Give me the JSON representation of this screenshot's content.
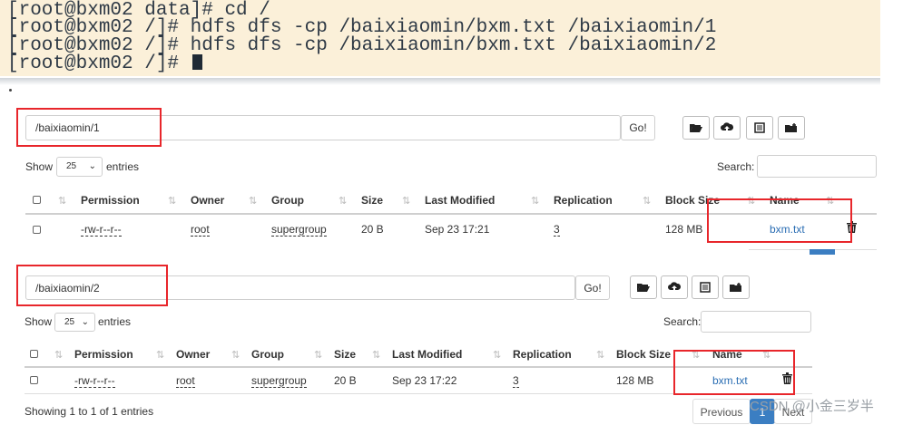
{
  "terminal": {
    "lines": [
      "[root@bxm02 data]# cd /",
      "[root@bxm02 /]# hdfs dfs -cp /baixiaomin/bxm.txt /baixiaomin/1",
      "[root@bxm02 /]# hdfs dfs -cp /baixiaomin/bxm.txt /baixiaomin/2",
      "[root@bxm02 /]# "
    ]
  },
  "panel1": {
    "path_value": "/baixiaomin/1",
    "go_label": "Go!",
    "show_label": "Show",
    "entries_select": "25",
    "entries_label": "entries",
    "search_label": "Search:",
    "columns": [
      "Permission",
      "Owner",
      "Group",
      "Size",
      "Last Modified",
      "Replication",
      "Block Size",
      "Name"
    ],
    "row": {
      "permission": "-rw-r--r--",
      "owner": "root",
      "group": "supergroup",
      "size": "20 B",
      "last_modified": "Sep 23 17:21",
      "replication": "3",
      "block_size": "128 MB",
      "name": "bxm.txt"
    }
  },
  "panel2": {
    "path_value": "/baixiaomin/2",
    "go_label": "Go!",
    "show_label": "Show",
    "entries_select": "25",
    "entries_label": "entries",
    "search_label": "Search:",
    "columns": [
      "Permission",
      "Owner",
      "Group",
      "Size",
      "Last Modified",
      "Replication",
      "Block Size",
      "Name"
    ],
    "row": {
      "permission": "-rw-r--r--",
      "owner": "root",
      "group": "supergroup",
      "size": "20 B",
      "last_modified": "Sep 23 17:22",
      "replication": "3",
      "block_size": "128 MB",
      "name": "bxm.txt"
    },
    "info": "Showing 1 to 1 of 1 entries",
    "pager": {
      "previous": "Previous",
      "page": "1",
      "next": "Next"
    }
  },
  "icons": [
    "folder-open-icon",
    "upload-icon",
    "list-icon",
    "folder-plus-icon",
    "trash-icon",
    "sort-icon"
  ],
  "watermark": "CSDN @小金三岁半",
  "colors": {
    "terminal_bg": "#fbf0d9",
    "highlight": "#e8262b",
    "link": "#2a6db3",
    "accent": "#3b7ec2"
  }
}
